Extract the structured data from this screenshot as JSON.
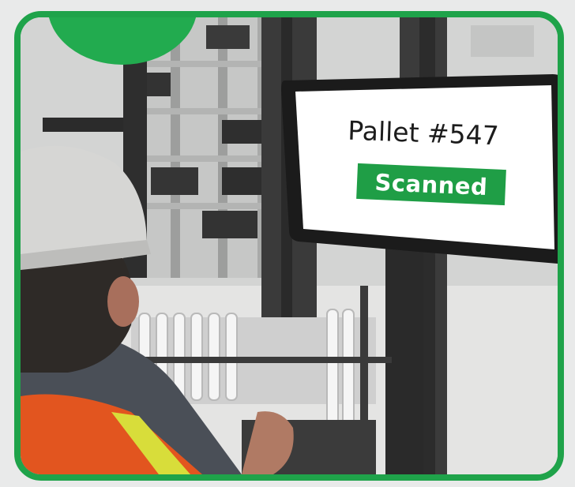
{
  "display": {
    "pallet_label": "Pallet #547",
    "status": "Scanned"
  },
  "colors": {
    "frame_border": "#1fa34a",
    "badge_green": "#1f9e46",
    "vest_orange": "#e2551f",
    "reflective_yellow": "#d8dd3a"
  },
  "icons": [
    "hard-hat",
    "safety-vest"
  ]
}
